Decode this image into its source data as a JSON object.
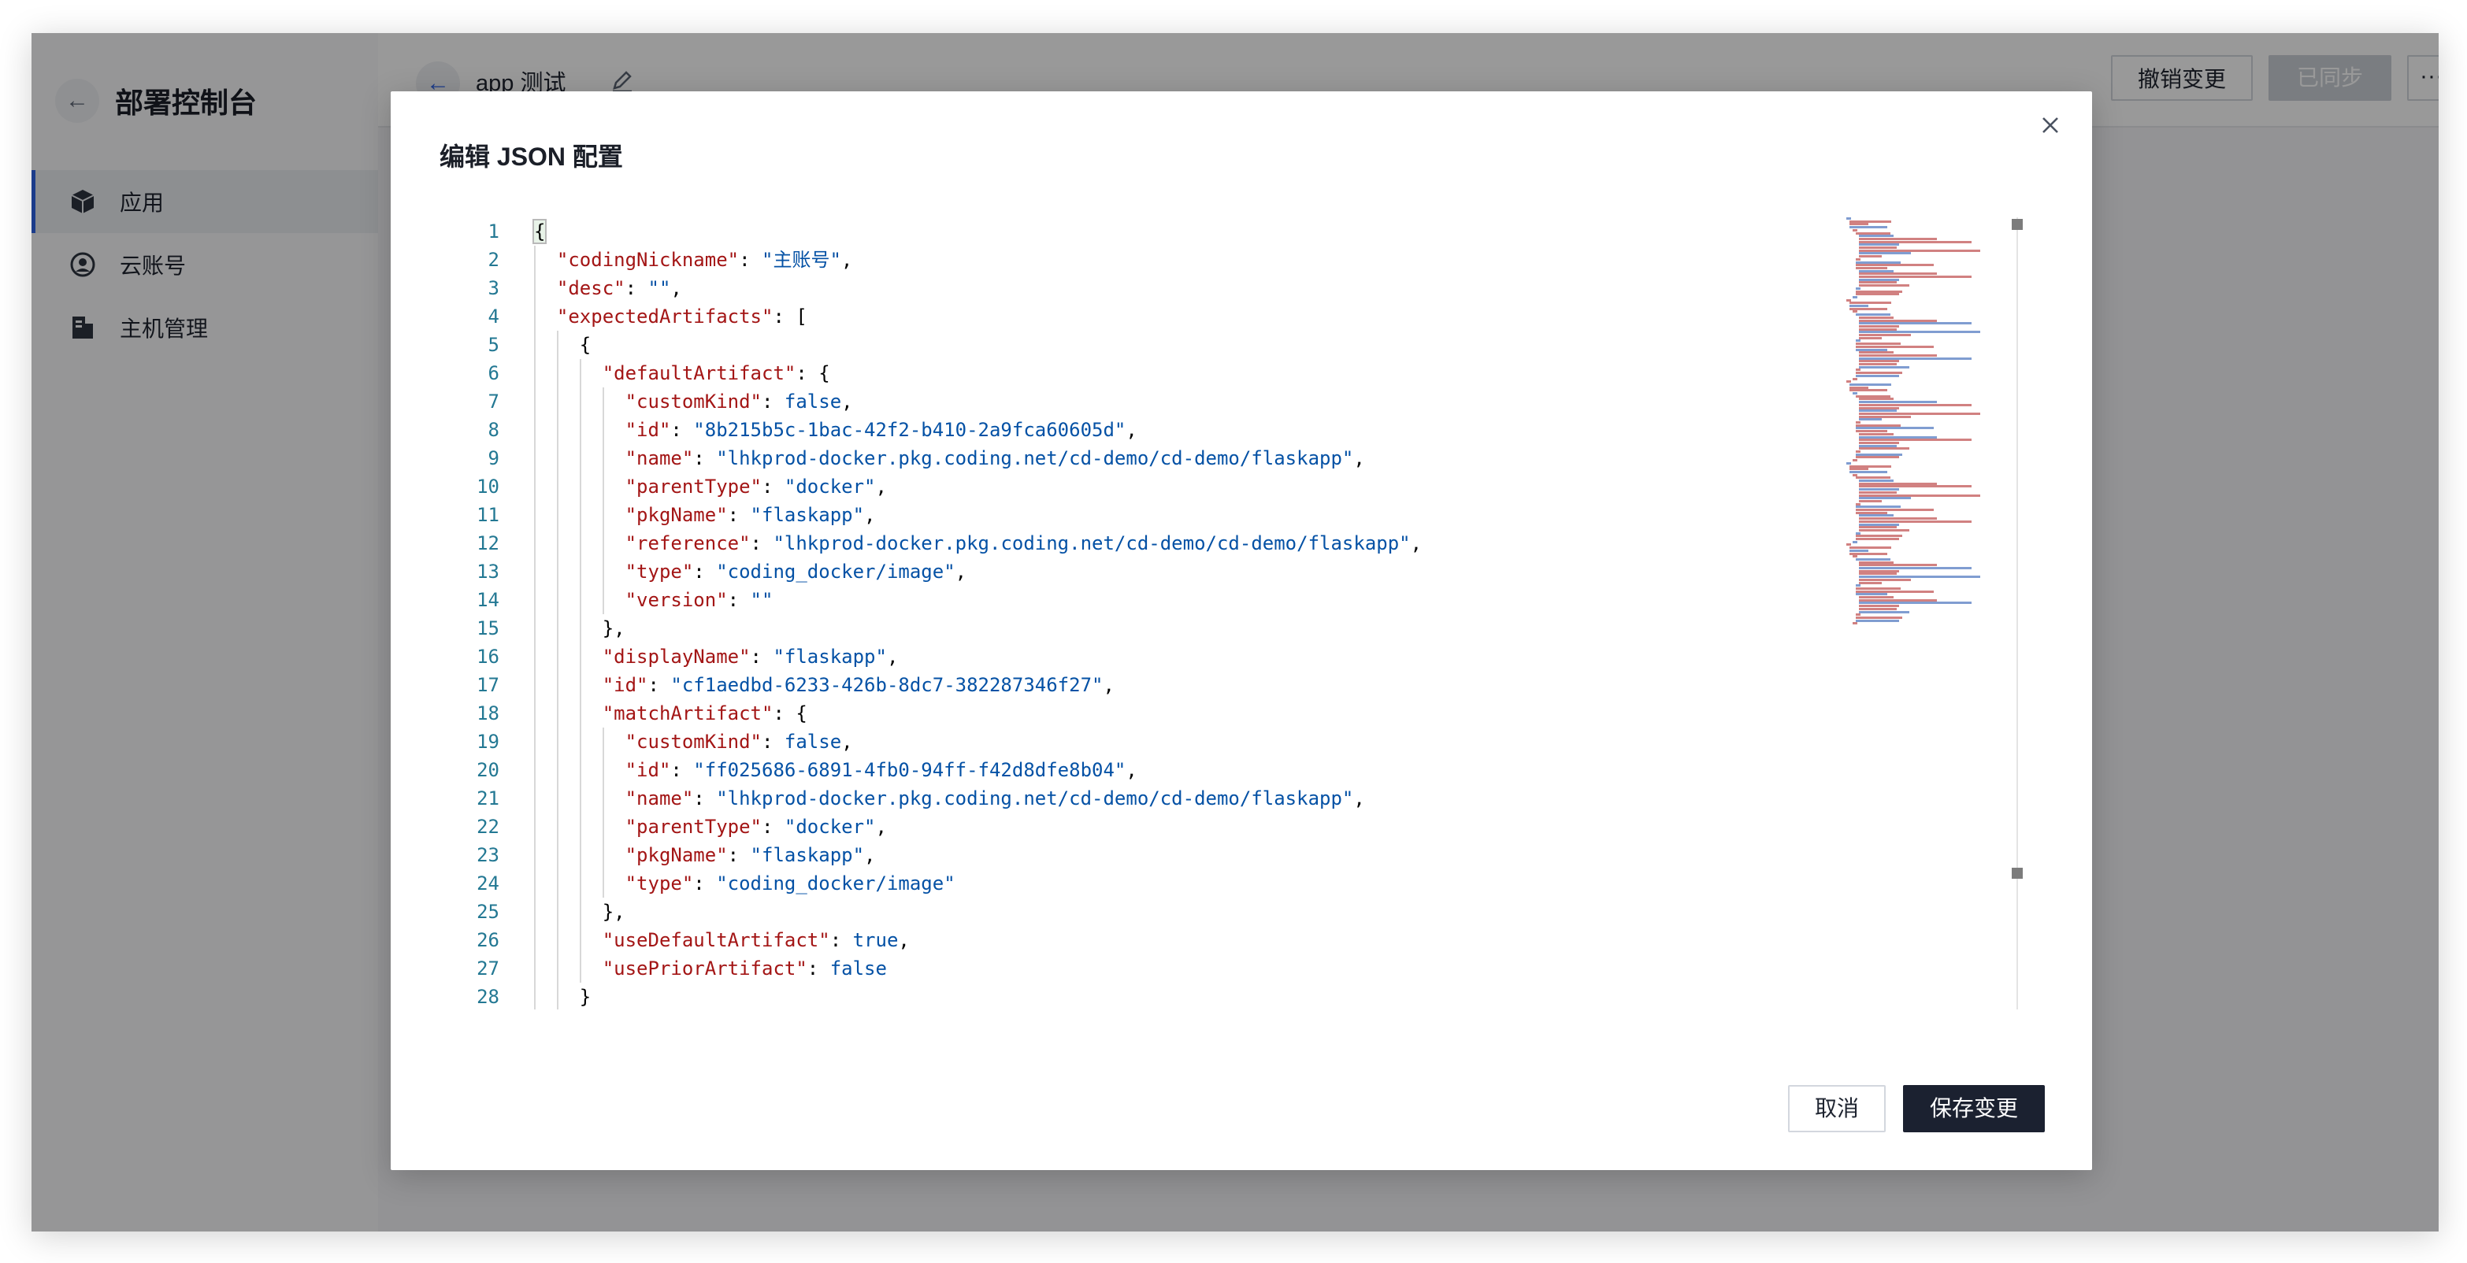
{
  "app": {
    "sidebar": {
      "title": "部署控制台",
      "items": [
        {
          "label": "应用",
          "icon": "package-icon",
          "active": true
        },
        {
          "label": "云账号",
          "icon": "user-circle-icon",
          "active": false
        },
        {
          "label": "主机管理",
          "icon": "server-icon",
          "active": false
        }
      ]
    },
    "topbar": {
      "app_name": "app 测试",
      "revert_label": "撤销变更",
      "synced_label": "已同步",
      "more_label": "···"
    }
  },
  "modal": {
    "title": "编辑 JSON 配置",
    "cancel_label": "取消",
    "save_label": "保存变更"
  },
  "editor": {
    "lines": [
      {
        "n": "1",
        "text": "{"
      },
      {
        "n": "2",
        "text": "  \"codingNickname\": \"主账号\","
      },
      {
        "n": "3",
        "text": "  \"desc\": \"\","
      },
      {
        "n": "4",
        "text": "  \"expectedArtifacts\": ["
      },
      {
        "n": "5",
        "text": "    {"
      },
      {
        "n": "6",
        "text": "      \"defaultArtifact\": {"
      },
      {
        "n": "7",
        "text": "        \"customKind\": false,"
      },
      {
        "n": "8",
        "text": "        \"id\": \"8b215b5c-1bac-42f2-b410-2a9fca60605d\","
      },
      {
        "n": "9",
        "text": "        \"name\": \"lhkprod-docker.pkg.coding.net/cd-demo/cd-demo/flaskapp\","
      },
      {
        "n": "10",
        "text": "        \"parentType\": \"docker\","
      },
      {
        "n": "11",
        "text": "        \"pkgName\": \"flaskapp\","
      },
      {
        "n": "12",
        "text": "        \"reference\": \"lhkprod-docker.pkg.coding.net/cd-demo/cd-demo/flaskapp\","
      },
      {
        "n": "13",
        "text": "        \"type\": \"coding_docker/image\","
      },
      {
        "n": "14",
        "text": "        \"version\": \"\""
      },
      {
        "n": "15",
        "text": "      },"
      },
      {
        "n": "16",
        "text": "      \"displayName\": \"flaskapp\","
      },
      {
        "n": "17",
        "text": "      \"id\": \"cf1aedbd-6233-426b-8dc7-382287346f27\","
      },
      {
        "n": "18",
        "text": "      \"matchArtifact\": {"
      },
      {
        "n": "19",
        "text": "        \"customKind\": false,"
      },
      {
        "n": "20",
        "text": "        \"id\": \"ff025686-6891-4fb0-94ff-f42d8dfe8b04\","
      },
      {
        "n": "21",
        "text": "        \"name\": \"lhkprod-docker.pkg.coding.net/cd-demo/cd-demo/flaskapp\","
      },
      {
        "n": "22",
        "text": "        \"parentType\": \"docker\","
      },
      {
        "n": "23",
        "text": "        \"pkgName\": \"flaskapp\","
      },
      {
        "n": "24",
        "text": "        \"type\": \"coding_docker/image\""
      },
      {
        "n": "25",
        "text": "      },"
      },
      {
        "n": "26",
        "text": "      \"useDefaultArtifact\": true,"
      },
      {
        "n": "27",
        "text": "      \"usePriorArtifact\": false"
      },
      {
        "n": "28",
        "text": "    }"
      }
    ]
  },
  "colors": {
    "key": "#a31515",
    "string": "#0451a5",
    "line_number": "#237893",
    "accent": "#2f64e6",
    "save_button": "#1b2130"
  }
}
